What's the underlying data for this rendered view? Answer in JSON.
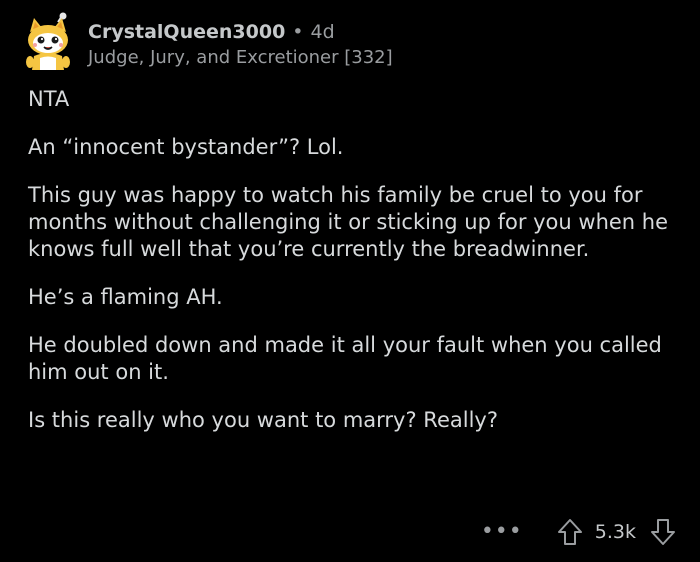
{
  "comment": {
    "username": "CrystalQueen3000",
    "separator": "•",
    "age": "4d",
    "flair": "Judge, Jury, and Excretioner [332]",
    "paragraphs": [
      "NTA",
      "An “innocent bystander”? Lol.",
      "This guy was happy to watch his family be cruel to you for months without challenging it or sticking up for you when he knows full well that you’re currently the breadwinner.",
      "He’s a flaming AH.",
      "He doubled down and made it all your fault when you called him out on it.",
      "Is this really who you want to marry? Really?"
    ],
    "score": "5.3k",
    "more_label": "•••"
  },
  "icons": {
    "avatar": "snoo-avatar-yellow-cat",
    "more": "more-options-icon",
    "upvote": "upvote-arrow-icon",
    "downvote": "downvote-arrow-icon"
  },
  "colors": {
    "background": "#000000",
    "text": "#d7dadc",
    "meta": "#9a9da0",
    "avatar": "#f5c542"
  }
}
